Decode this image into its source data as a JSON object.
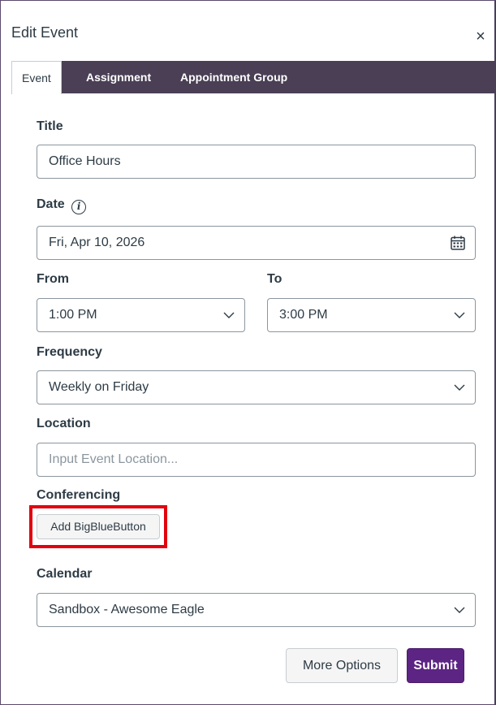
{
  "dialog": {
    "title": "Edit Event",
    "close_label": "×"
  },
  "tabs": [
    {
      "label": "Event",
      "active": true
    },
    {
      "label": "Assignment",
      "active": false
    },
    {
      "label": "Appointment Group",
      "active": false
    }
  ],
  "form": {
    "title_label": "Title",
    "title_value": "Office Hours",
    "date_label": "Date",
    "date_info_icon": "info-icon",
    "date_value": "Fri, Apr 10, 2026",
    "date_icon": "calendar-icon",
    "from_label": "From",
    "from_value": "1:00 PM",
    "to_label": "To",
    "to_value": "3:00 PM",
    "frequency_label": "Frequency",
    "frequency_value": "Weekly on Friday",
    "location_label": "Location",
    "location_placeholder": "Input Event Location...",
    "location_value": "",
    "conferencing_label": "Conferencing",
    "conferencing_button": "Add BigBlueButton",
    "calendar_label": "Calendar",
    "calendar_value": "Sandbox - Awesome Eagle"
  },
  "actions": {
    "more_options": "More Options",
    "submit": "Submit"
  },
  "colors": {
    "tabbar_bg": "#4a3f55",
    "submit_bg": "#5c2483",
    "highlight": "#e3000f"
  }
}
